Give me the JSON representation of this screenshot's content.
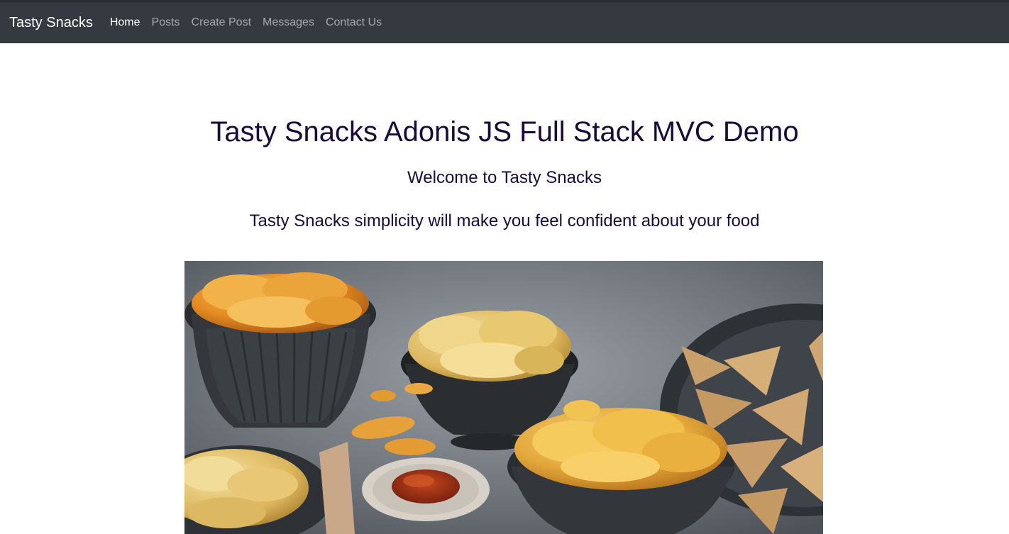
{
  "navbar": {
    "brand": "Tasty Snacks",
    "items": [
      {
        "label": "Home",
        "active": true
      },
      {
        "label": "Posts",
        "active": false
      },
      {
        "label": "Create Post",
        "active": false
      },
      {
        "label": "Messages",
        "active": false
      },
      {
        "label": "Contact Us",
        "active": false
      }
    ]
  },
  "main": {
    "title": "Tasty Snacks Adonis JS Full Stack MVC Demo",
    "subtitle": "Welcome to Tasty Snacks",
    "tagline": "Tasty Snacks simplicity will make you feel confident about your food",
    "hero_image": "snack-bowls-photo"
  },
  "colors": {
    "navbar_bg": "#343a40",
    "heading_text": "#1a0a3a",
    "nav_active": "#ffffff",
    "nav_inactive": "#9a9da0"
  }
}
